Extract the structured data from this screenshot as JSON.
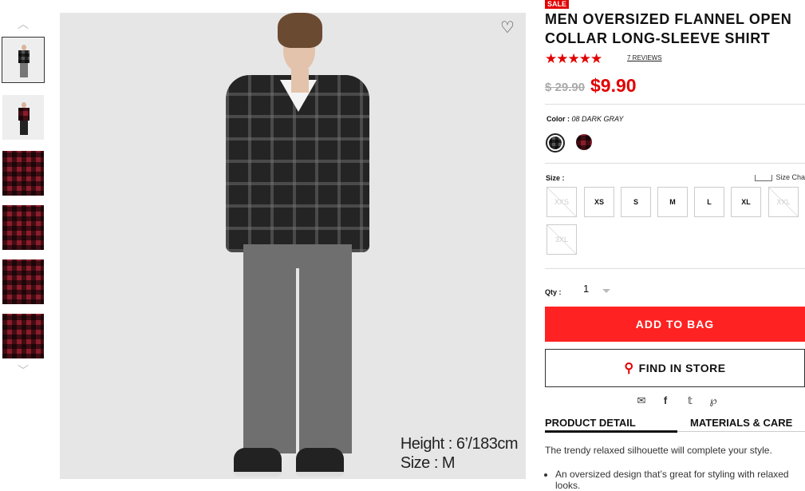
{
  "product": {
    "badge": "SALE",
    "title": "MEN OVERSIZED FLANNEL OPEN COLLAR LONG-SLEEVE SHIRT",
    "rating": 5,
    "reviews": "7 REVIEWS",
    "original_price": "$ 29.90",
    "sale_price": "$9.90",
    "color_label": "Color :",
    "color_value": "08 DARK GRAY",
    "colors": [
      {
        "name": "dark-gray-plaid",
        "hex": "#444444",
        "selected": true
      },
      {
        "name": "red-plaid",
        "hex": "#7a1a2a",
        "selected": false
      }
    ],
    "size_label": "Size :",
    "size_chart": "Size Cha",
    "sizes": [
      {
        "label": "XXS",
        "available": false
      },
      {
        "label": "XS",
        "available": true
      },
      {
        "label": "S",
        "available": true
      },
      {
        "label": "M",
        "available": true
      },
      {
        "label": "L",
        "available": true
      },
      {
        "label": "XL",
        "available": true
      },
      {
        "label": "XXL",
        "available": false
      },
      {
        "label": "3XL",
        "available": false
      }
    ],
    "qty_label": "Qty :",
    "qty_value": "1",
    "add_to_bag": "ADD TO BAG",
    "find_in_store": "FIND IN STORE"
  },
  "gallery": {
    "caption_height": "Height : 6’/183cm",
    "caption_size": "Size : M"
  },
  "tabs": {
    "detail": "PRODUCT DETAIL",
    "materials": "MATERIALS & CARE"
  },
  "description": {
    "intro": "The trendy relaxed silhouette will complete your style.",
    "bullet1": "An oversized design that’s great for styling with relaxed looks."
  },
  "colors": {
    "accent": "#ff2222",
    "sale_red": "#e20000"
  }
}
